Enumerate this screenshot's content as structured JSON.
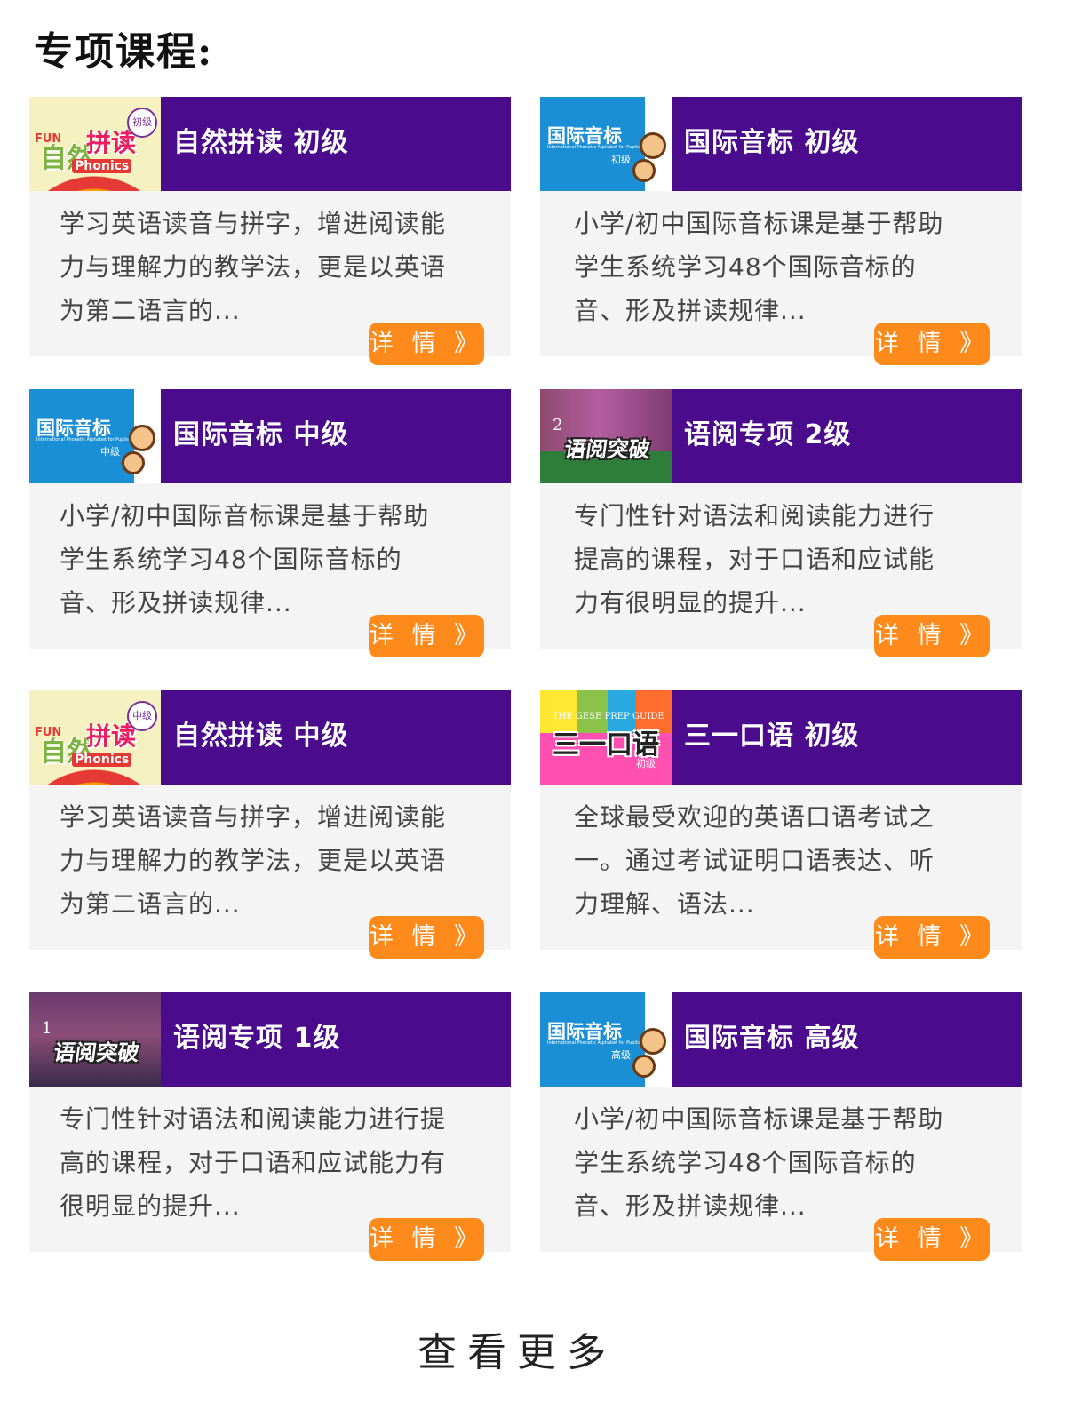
{
  "section_title": "专项课程:",
  "button_label": "详 情 》",
  "more_label": "查看更多",
  "colors": {
    "header_bg": "#4a0b8c",
    "card_bg": "#f4f4f4",
    "button_bg": "#ff8a1c"
  },
  "courses": [
    {
      "title": "自然拼读 初级",
      "desc_lines": [
        "学习英语读音与拼字，增进阅读能",
        "力与理解力的教学法，更是以英语",
        "为第二语言的..."
      ],
      "thumb": {
        "type": "phonics",
        "fun": "FUN",
        "main": "自然",
        "main2": "拼读",
        "phonics": "Phonics",
        "level": "初级"
      }
    },
    {
      "title": "国际音标 初级",
      "desc_lines": [
        "小学/初中国际音标课是基于帮助",
        "学生系统学习48个国际音标的",
        "音、形及拼读规律..."
      ],
      "thumb": {
        "type": "ipa",
        "title": "国际音标",
        "subtitle": "International Phonetic Alphabet for Pupils",
        "level": "初级"
      }
    },
    {
      "title": "国际音标 中级",
      "desc_lines": [
        "小学/初中国际音标课是基于帮助",
        "学生系统学习48个国际音标的",
        "音、形及拼读规律..."
      ],
      "thumb": {
        "type": "ipa",
        "title": "国际音标",
        "subtitle": "International Phonetic Alphabet for Pupils",
        "level": "中级"
      }
    },
    {
      "title": "语阅专项 2级",
      "desc_lines": [
        "专门性针对语法和阅读能力进行",
        "提高的课程，对于口语和应试能",
        "力有很明显的提升..."
      ],
      "thumb": {
        "type": "read",
        "num": "2",
        "logo": "语阅突破"
      }
    },
    {
      "title": "自然拼读 中级",
      "desc_lines": [
        "学习英语读音与拼字，增进阅读能",
        "力与理解力的教学法，更是以英语",
        "为第二语言的..."
      ],
      "thumb": {
        "type": "phonics",
        "fun": "FUN",
        "main": "自然",
        "main2": "拼读",
        "phonics": "Phonics",
        "level": "中级"
      }
    },
    {
      "title": "三一口语 初级",
      "desc_lines": [
        "全球最受欢迎的英语口语考试之",
        "一。通过考试证明口语表达、听",
        "力理解、语法..."
      ],
      "thumb": {
        "type": "gese",
        "en": "THE GESE PREP GUIDE",
        "main": "三一口语",
        "level": "初级"
      }
    },
    {
      "title": "语阅专项 1级",
      "desc_lines": [
        "专门性针对语法和阅读能力进行提",
        "高的课程，对于口语和应试能力有",
        "很明显的提升..."
      ],
      "thumb": {
        "type": "read",
        "num": "1",
        "logo": "语阅突破"
      }
    },
    {
      "title": "国际音标 高级",
      "desc_lines": [
        "小学/初中国际音标课是基于帮助",
        "学生系统学习48个国际音标的",
        "音、形及拼读规律..."
      ],
      "thumb": {
        "type": "ipa",
        "title": "国际音标",
        "subtitle": "International Phonetic Alphabet for Pupils",
        "level": "高级"
      }
    }
  ]
}
